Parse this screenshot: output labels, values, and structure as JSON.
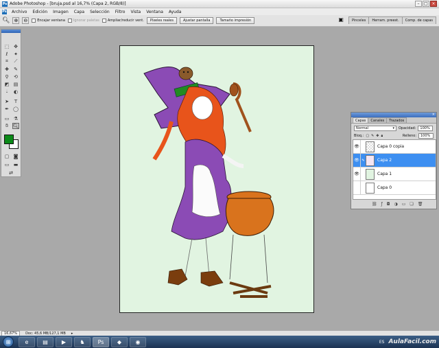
{
  "window": {
    "title": "Adobe Photoshop - [bruja.psd al 16,7% (Capa 2, RGB/8)]",
    "app_icon": "Ps"
  },
  "menu": [
    "Archivo",
    "Edición",
    "Imagen",
    "Capa",
    "Selección",
    "Filtro",
    "Vista",
    "Ventana",
    "Ayuda"
  ],
  "options": {
    "encajar": "Encajar ventana",
    "ignorar": "Ignorar paletas",
    "ampliar": "Ampliar/reducir vent.",
    "pixeles_reales": "Píxeles reales",
    "ajustar_pantalla": "Ajustar pantalla",
    "tamano_impresion": "Tamaño impresión"
  },
  "panel_well": [
    "Pinceles",
    "Herram. preest.",
    "Comp. de capas"
  ],
  "layers_panel": {
    "tabs": [
      "Capas",
      "Canales",
      "Trazados"
    ],
    "blend_mode": "Normal",
    "opacity_label": "Opacidad:",
    "opacity_value": "100%",
    "lock_label": "Bloq.:",
    "fill_label": "Relleno:",
    "fill_value": "100%",
    "layers": [
      {
        "name": "Capa 0 copia",
        "visible": true
      },
      {
        "name": "Capa 2",
        "visible": true,
        "selected": true
      },
      {
        "name": "Capa 1",
        "visible": true
      },
      {
        "name": "Capa 0",
        "visible": false
      }
    ]
  },
  "colors": {
    "foreground": "#0b8a19",
    "background": "#ffffff",
    "canvas_bg": "#e1f4e1",
    "selection": "#3d8ff1"
  },
  "status": {
    "zoom": "16,67%",
    "doc": "Doc: 45,6 MB/127,1 MB"
  },
  "taskbar": {
    "language": "ES",
    "watermark": "AulaFacil.com"
  }
}
